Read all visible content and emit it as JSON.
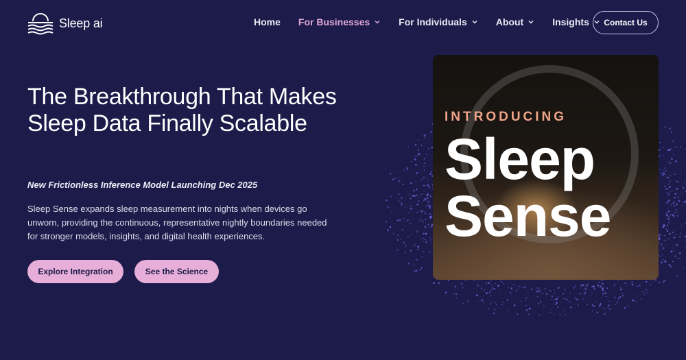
{
  "brand": {
    "name": "Sleep ai"
  },
  "nav": {
    "items": [
      {
        "label": "Home",
        "dropdown": false,
        "active": false
      },
      {
        "label": "For Businesses",
        "dropdown": true,
        "active": true
      },
      {
        "label": "For Individuals",
        "dropdown": true,
        "active": false
      },
      {
        "label": "About",
        "dropdown": true,
        "active": false
      },
      {
        "label": "Insights",
        "dropdown": true,
        "active": false
      }
    ],
    "contact_label": "Contact Us"
  },
  "hero": {
    "headline": "The Breakthrough That Makes Sleep Data Finally Scalable",
    "subhead": "New Frictionless Inference Model Launching Dec 2025",
    "body": "Sleep Sense expands sleep measurement into nights when devices go unworn, providing the continuous, representative nightly boundaries needed for stronger models, insights, and digital health experiences.",
    "primary_button": "Explore Integration",
    "secondary_button": "See the Science"
  },
  "promo": {
    "kicker": "INTRODUCING",
    "title_line1": "Sleep",
    "title_line2": "Sense"
  },
  "colors": {
    "background": "#1d1b4a",
    "accent_pink": "#e6aed8",
    "nav_active": "#e0a6d5",
    "promo_kicker": "#f0a58a",
    "dot_particles": "#6a66d8"
  },
  "icons": {
    "logo": "sun-over-waves-icon",
    "nav_dropdown": "chevron-down-icon"
  }
}
